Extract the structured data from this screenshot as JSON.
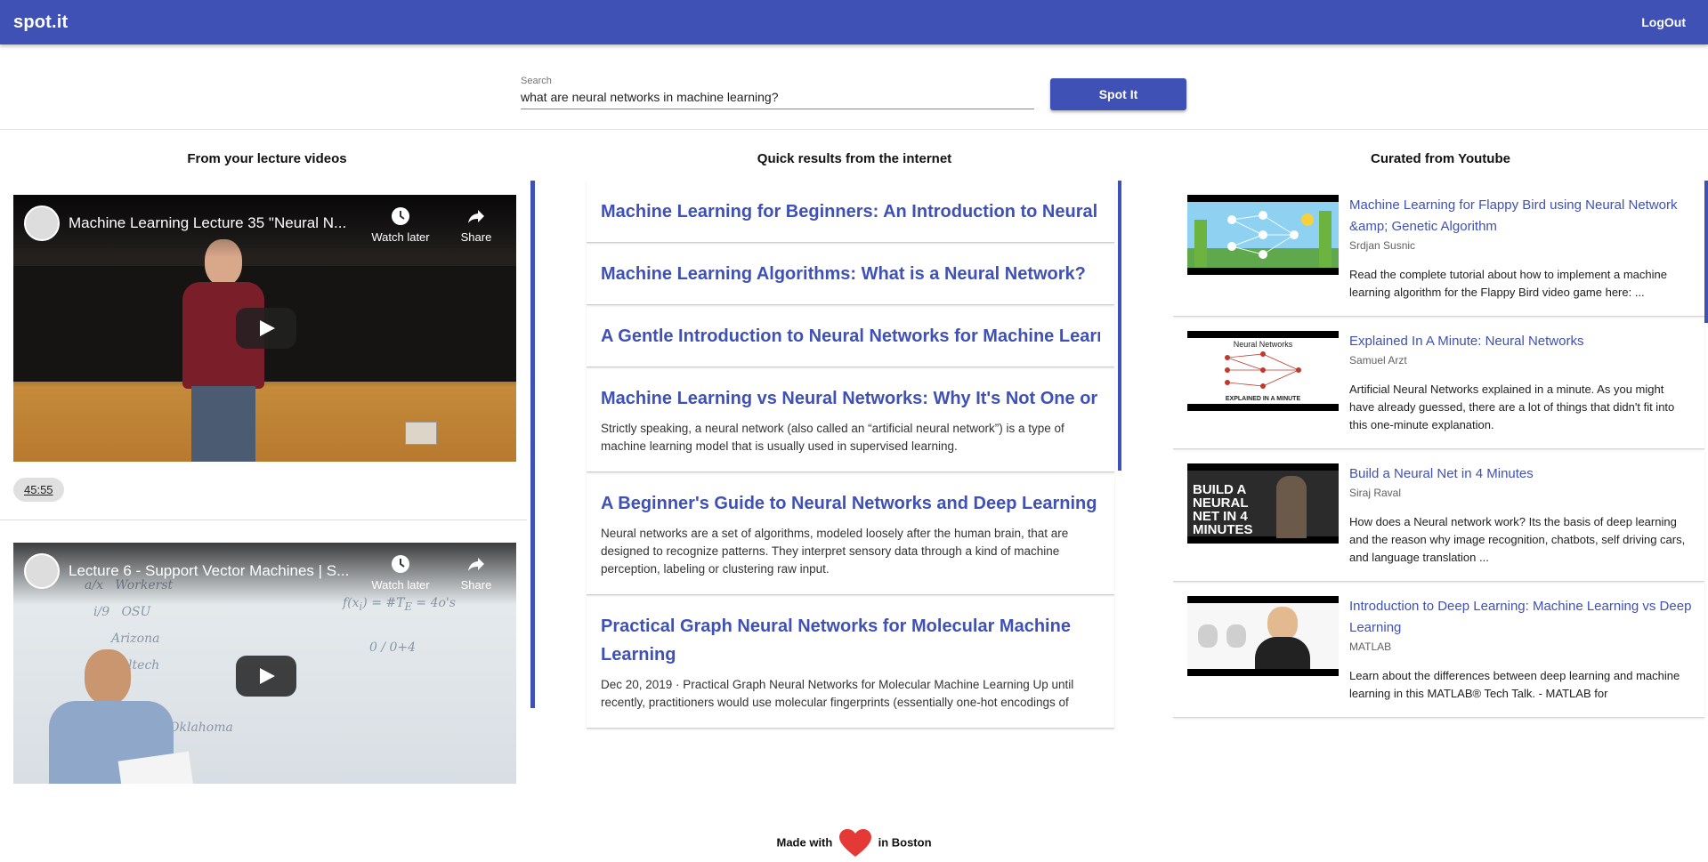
{
  "app": {
    "brand": "spot.it",
    "logout_label": "LogOut"
  },
  "search": {
    "label": "Search",
    "value": "what are neural networks in machine learning?",
    "button_label": "Spot It"
  },
  "columns": {
    "lecture_title": "From your lecture videos",
    "internet_title": "Quick results from the internet",
    "youtube_title": "Curated from Youtube"
  },
  "lecture_videos": [
    {
      "title": "Machine Learning Lecture 35 \"Neural N...",
      "watch_later": "Watch later",
      "share": "Share",
      "timestamp": "45:55"
    },
    {
      "title": "Lecture 6 - Support Vector Machines | S...",
      "watch_later": "Watch later",
      "share": "Share"
    }
  ],
  "internet_results": [
    {
      "title": "Machine Learning for Beginners: An Introduction to Neural ...",
      "snippet": ""
    },
    {
      "title": "Machine Learning Algorithms: What is a Neural Network?",
      "snippet": ""
    },
    {
      "title": "A Gentle Introduction to Neural Networks for Machine Learning",
      "snippet": ""
    },
    {
      "title": "Machine Learning vs Neural Networks: Why It's Not One or ...",
      "snippet": "Strictly speaking, a neural network (also called an “artificial neural network”) is a type of machine learning model that is usually used in supervised learning."
    },
    {
      "title": "A Beginner's Guide to Neural Networks and Deep Learning ...",
      "snippet": "Neural networks are a set of algorithms, modeled loosely after the human brain, that are designed to recognize patterns. They interpret sensory data through a kind of machine perception, labeling or clustering raw input."
    },
    {
      "title": "Practical Graph Neural Networks for Molecular Machine Learning",
      "snippet": "Dec 20, 2019 · Practical Graph Neural Networks for Molecular Machine Learning Up until recently, practitioners would use molecular fingerprints (essentially one-hot encodings of"
    }
  ],
  "youtube_results": [
    {
      "title": "Machine Learning for Flappy Bird using Neural Network &amp; Genetic Algorithm",
      "channel": "Srdjan Susnic",
      "description": "Read the complete tutorial about how to implement a machine learning algorithm for the Flappy Bird video game here: ..."
    },
    {
      "title": "Explained In A Minute: Neural Networks",
      "channel": "Samuel Arzt",
      "description": "Artificial Neural Networks explained in a minute. As you might have already guessed, there are a lot of things that didn't fit into this one-minute explanation.",
      "thumb_caption_top": "Neural Networks",
      "thumb_caption_bottom": "EXPLAINED IN A MINUTE"
    },
    {
      "title": "Build a Neural Net in 4 Minutes",
      "channel": "Siraj Raval",
      "description": "How does a Neural network work? Its the basis of deep learning and the reason why image recognition, chatbots, self driving cars, and language translation ...",
      "thumb_caption": "BUILD A NEURAL NET IN 4 MINUTES"
    },
    {
      "title": "Introduction to Deep Learning: Machine Learning vs Deep Learning",
      "channel": "MATLAB",
      "description": "Learn about the differences between deep learning and machine learning in this MATLAB® Tech Talk. - MATLAB for"
    }
  ],
  "footer": {
    "before": "Made with",
    "after": "in Boston"
  },
  "colors": {
    "primary": "#3f51b5",
    "heart": "#e53935"
  }
}
